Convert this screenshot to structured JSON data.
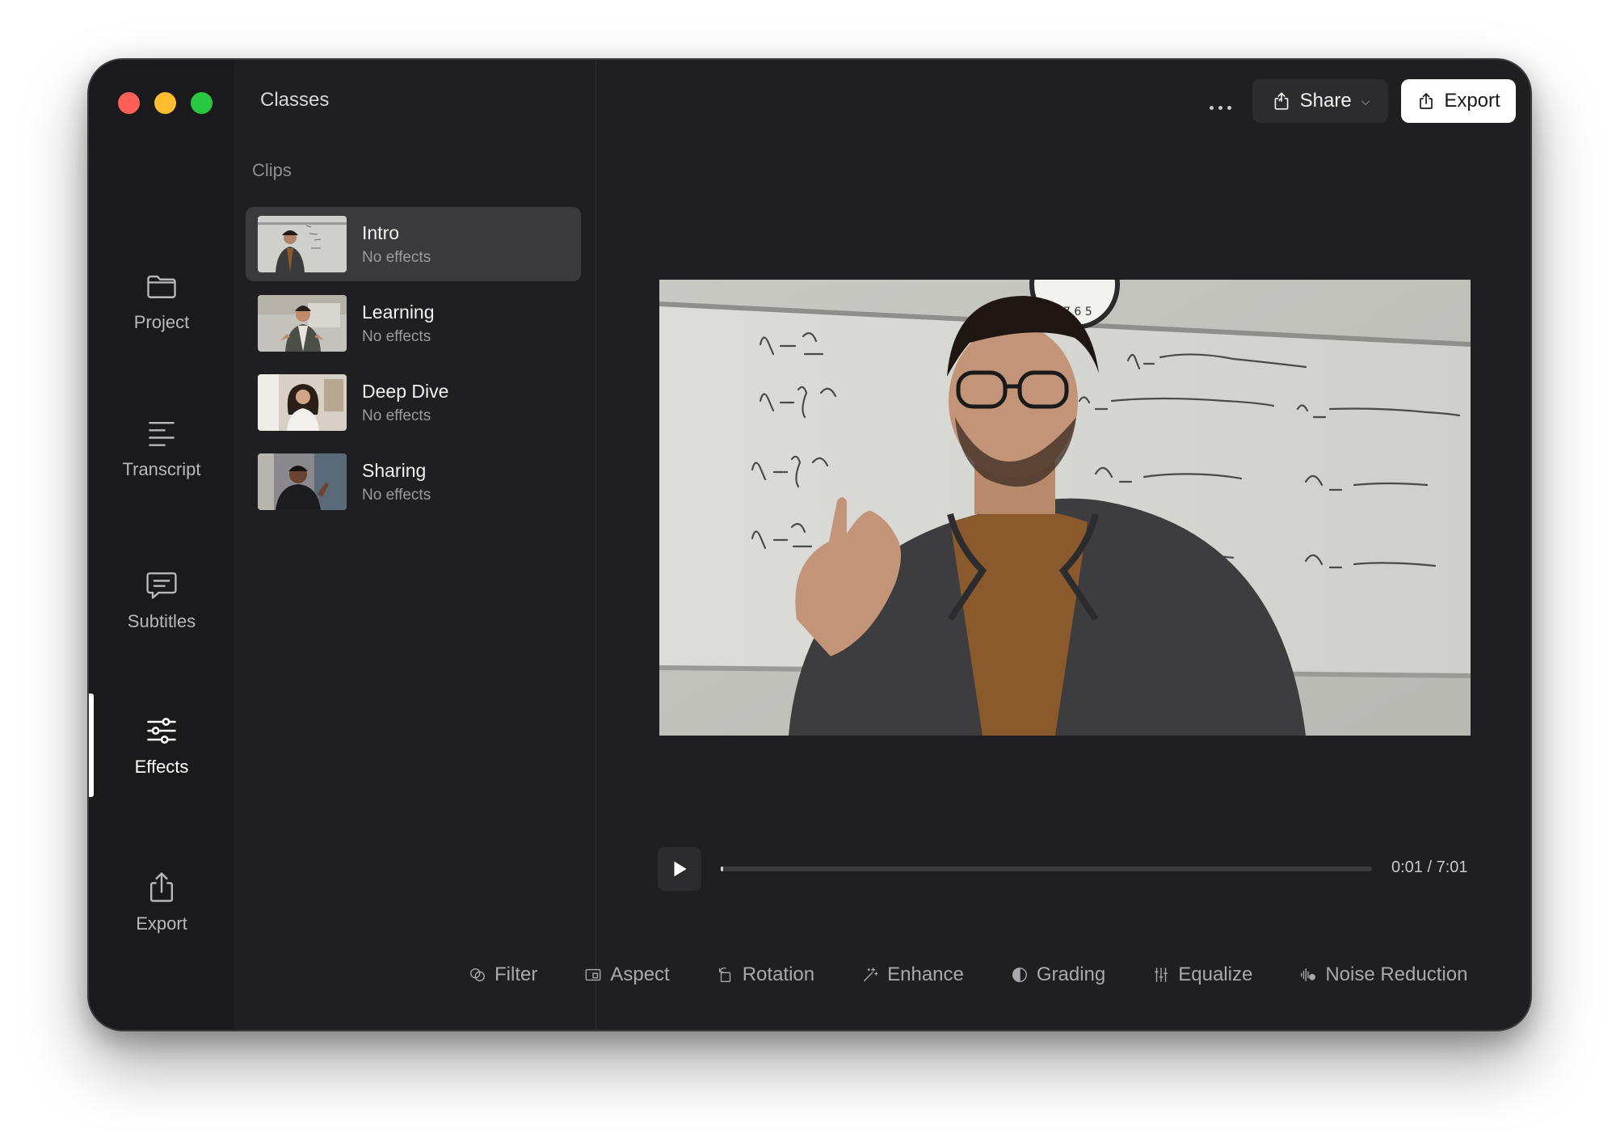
{
  "window": {
    "title": "Classes"
  },
  "nav": {
    "items": [
      {
        "label": "Project",
        "icon": "folder-icon"
      },
      {
        "label": "Transcript",
        "icon": "transcript-icon"
      },
      {
        "label": "Subtitles",
        "icon": "subtitles-icon"
      },
      {
        "label": "Effects",
        "icon": "sliders-icon",
        "active": true
      },
      {
        "label": "Export",
        "icon": "export-icon"
      }
    ]
  },
  "clips": {
    "label": "Clips",
    "items": [
      {
        "name": "Intro",
        "status": "No effects",
        "active": true
      },
      {
        "name": "Learning",
        "status": "No effects"
      },
      {
        "name": "Deep Dive",
        "status": "No effects"
      },
      {
        "name": "Sharing",
        "status": "No effects"
      }
    ]
  },
  "header": {
    "share_label": "Share",
    "export_label": "Export"
  },
  "player": {
    "time": "0:01 / 7:01",
    "progress": 0.002
  },
  "toolbar": {
    "tools": [
      {
        "label": "Filter",
        "icon": "filter-icon"
      },
      {
        "label": "Aspect",
        "icon": "aspect-icon"
      },
      {
        "label": "Rotation",
        "icon": "rotation-icon"
      },
      {
        "label": "Enhance",
        "icon": "enhance-icon"
      },
      {
        "label": "Grading",
        "icon": "grading-icon"
      },
      {
        "label": "Equalize",
        "icon": "equalize-icon"
      },
      {
        "label": "Noise Reduction",
        "icon": "noise-reduction-icon"
      }
    ]
  },
  "colors": {
    "window_bg": "#1f1f21",
    "traffic_red": "#fe5f57",
    "traffic_yellow": "#febc2e",
    "traffic_green": "#28c840"
  }
}
